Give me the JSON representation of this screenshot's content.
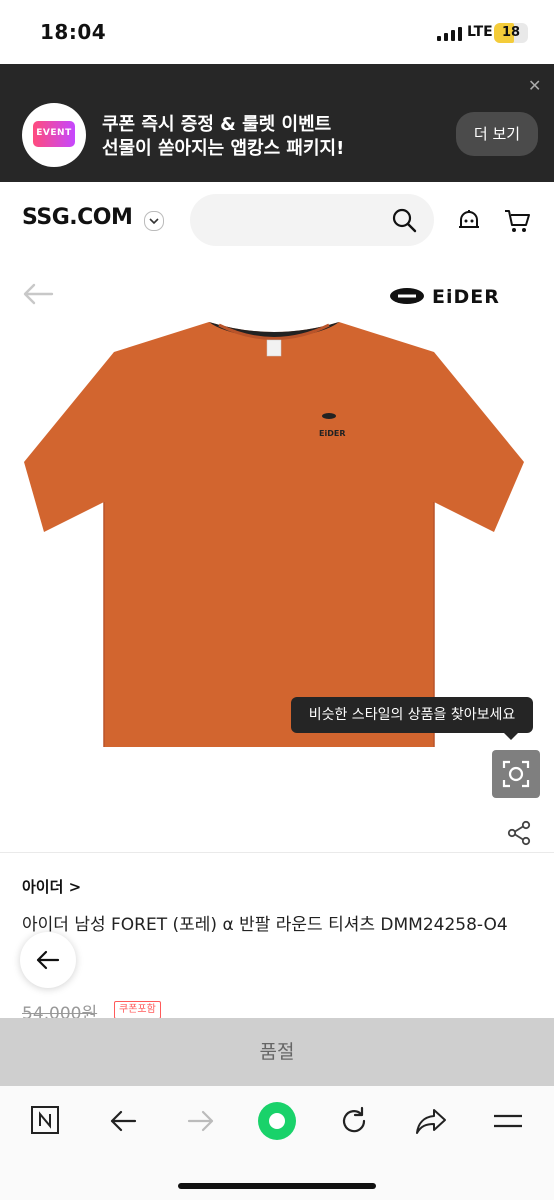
{
  "status_bar": {
    "time": "18:04",
    "network": "LTE",
    "battery": "18"
  },
  "promo": {
    "badge": "EVENT",
    "line1": "쿠폰 즉시 증정 & 룰렛 이벤트",
    "line2": "선물이 쏟아지는 앱캉스 패키지!",
    "button": "더 보기",
    "close_icon": "close-icon"
  },
  "header": {
    "logo": "SSG.COM",
    "search_placeholder": "",
    "icons": [
      "chevron-down-icon",
      "search-icon",
      "bot-icon",
      "cart-icon"
    ]
  },
  "product": {
    "brand_logo": "EIDER",
    "image_color": "#d2652f",
    "tooltip": "비슷한 스타일의 상품을 찾아보세요",
    "brand": "아이더 >",
    "title": "아이더 남성 FORET (포레) α 반팔 라운드 티셔츠 DMM24258-O4",
    "price": "54,000원",
    "coupon_badge": "쿠폰포함",
    "status": "품절"
  },
  "browser_toolbar": {
    "icons": [
      "tabs-icon",
      "back-icon",
      "forward-icon",
      "home-icon",
      "reload-icon",
      "share-icon",
      "menu-icon"
    ]
  },
  "colors": {
    "accent_green": "#19d26a",
    "banner_bg": "#272727",
    "soldout_bg": "#cfcfcf"
  }
}
